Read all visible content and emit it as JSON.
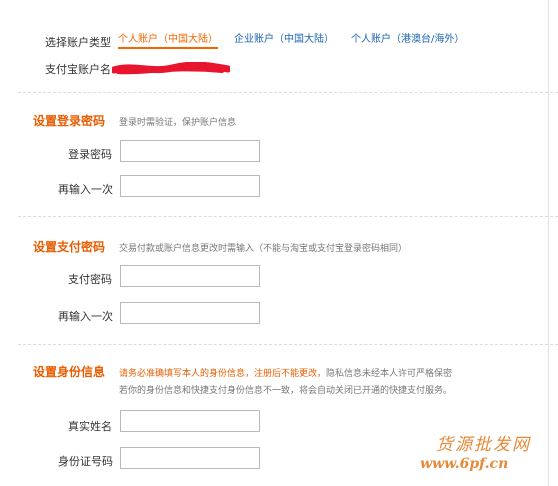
{
  "account": {
    "type_label": "选择账户类型",
    "tabs": [
      {
        "label": "个人账户（中国大陆）",
        "active": true
      },
      {
        "label": "企业账户（中国大陆）",
        "active": false
      },
      {
        "label": "个人账户（港澳台/海外）",
        "active": false
      }
    ],
    "name_label": "支付宝账户名"
  },
  "login": {
    "title": "设置登录密码",
    "hint": "登录时需验证，保护账户信息",
    "password_label": "登录密码",
    "confirm_label": "再输入一次"
  },
  "payment": {
    "title": "设置支付密码",
    "hint": "交易付款或账户信息更改时需输入（不能与淘宝或支付宝登录密码相同）",
    "password_label": "支付密码",
    "confirm_label": "再输入一次"
  },
  "identity": {
    "title": "设置身份信息",
    "hint_warning": "请务必准确填写本人的身份信息，注册后不能更改，",
    "hint_rest": "隐私信息未经本人许可严格保密",
    "hint_line2": "若你的身份信息和快捷支付身份信息不一致，将会自动关闭已开通的快捷支付服务。",
    "name_label": "真实姓名",
    "id_label": "身份证号码"
  },
  "watermark": {
    "text_cn": "货源批发网",
    "url": "www.6pf.cn"
  },
  "colors": {
    "accent": "#e85d00",
    "link": "#1a64b4",
    "redaction": "#e8152e"
  }
}
